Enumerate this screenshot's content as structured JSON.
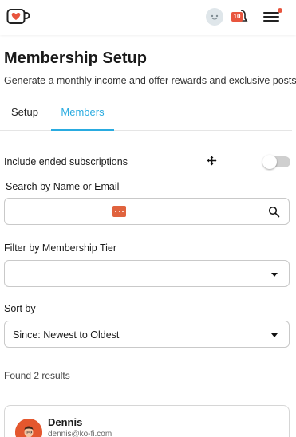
{
  "header": {
    "notification_count": "10",
    "icons": [
      "kofi-cup-logo-icon",
      "user-avatar-icon",
      "bell-icon",
      "hamburger-menu-icon"
    ]
  },
  "page": {
    "title": "Membership Setup",
    "subtitle": "Generate a monthly income and offer rewards and exclusive posts."
  },
  "tabs": [
    {
      "label": "Setup",
      "active": false
    },
    {
      "label": "Members",
      "active": true
    }
  ],
  "filters": {
    "include_ended_label": "Include ended subscriptions",
    "include_ended_on": false,
    "search_label": "Search by Name or Email",
    "search_value": "",
    "tier_label": "Filter by Membership Tier",
    "tier_value": "",
    "sort_label": "Sort by",
    "sort_value": "Since: Newest to Oldest"
  },
  "results": {
    "summary": "Found 2 results",
    "members": [
      {
        "name": "Dennis",
        "email": "dennis@ko-fi.com"
      }
    ]
  },
  "colors": {
    "accent": "#29abe0",
    "brand": "#e8553e",
    "toggle_off": "#cfcfcf"
  }
}
